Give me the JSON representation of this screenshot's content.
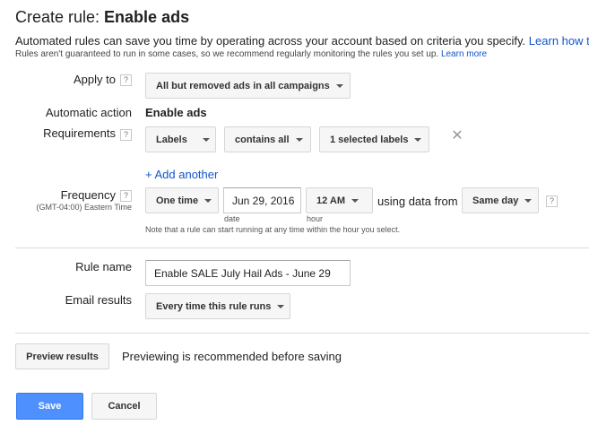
{
  "header": {
    "title_prefix": "Create rule: ",
    "title_name": "Enable ads",
    "intro": "Automated rules can save you time by operating across your account based on criteria you specify.",
    "intro_link": "Learn how t",
    "disclaimer": "Rules aren't guaranteed to run in some cases, so we recommend regularly monitoring the rules you set up.",
    "disclaimer_link": "Learn more"
  },
  "apply_to": {
    "label": "Apply to",
    "help": "?",
    "value": "All but removed ads in all campaigns"
  },
  "action": {
    "label": "Automatic action",
    "value": "Enable ads"
  },
  "requirements": {
    "label": "Requirements",
    "help": "?",
    "field": "Labels",
    "operator": "contains all",
    "selection": "1 selected labels",
    "add_another": "+ Add another"
  },
  "frequency": {
    "label": "Frequency",
    "help": "?",
    "timezone": "(GMT-04:00) Eastern Time",
    "type": "One time",
    "date": "Jun 29, 2016",
    "date_caption": "date",
    "hour": "12 AM",
    "hour_caption": "hour",
    "using_text": "using data from",
    "data_range": "Same day",
    "data_help": "?",
    "note": "Note that a rule can start running at any time within the hour you select."
  },
  "rule_name": {
    "label": "Rule name",
    "value": "Enable SALE July Hail Ads - June 29"
  },
  "email": {
    "label": "Email results",
    "value": "Every time this rule runs"
  },
  "preview": {
    "button": "Preview results",
    "message": "Previewing is recommended before saving"
  },
  "footer": {
    "save": "Save",
    "cancel": "Cancel"
  },
  "colors": {
    "primary": "#4d90fe",
    "link": "#1155cc"
  }
}
